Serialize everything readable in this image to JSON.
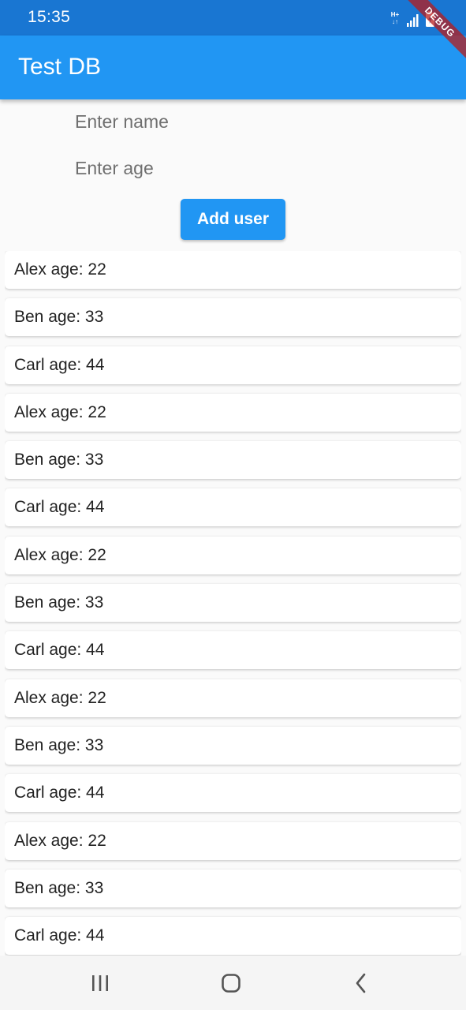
{
  "status_bar": {
    "time": "15:35",
    "network_label": "H+"
  },
  "debug_banner": "DEBUG",
  "app_bar": {
    "title": "Test DB"
  },
  "form": {
    "name_placeholder": "Enter name",
    "age_placeholder": "Enter age",
    "name_value": "",
    "age_value": "",
    "add_button_label": "Add user"
  },
  "users": [
    "Alex age: 22",
    "Ben age: 33",
    "Carl age: 44",
    "Alex age: 22",
    "Ben age: 33",
    "Carl age: 44",
    "Alex age: 22",
    "Ben age: 33",
    "Carl age: 44",
    "Alex age: 22",
    "Ben age: 33",
    "Carl age: 44",
    "Alex age: 22",
    "Ben age: 33",
    "Carl age: 44"
  ],
  "colors": {
    "status_bar": "#1976d2",
    "app_bar": "#2196f3",
    "button": "#2196f3",
    "background": "#fafafa"
  },
  "icons": {
    "signal": "signal-icon",
    "battery": "battery-icon",
    "nav_recents": "recents-icon",
    "nav_home": "home-icon",
    "nav_back": "back-icon"
  }
}
